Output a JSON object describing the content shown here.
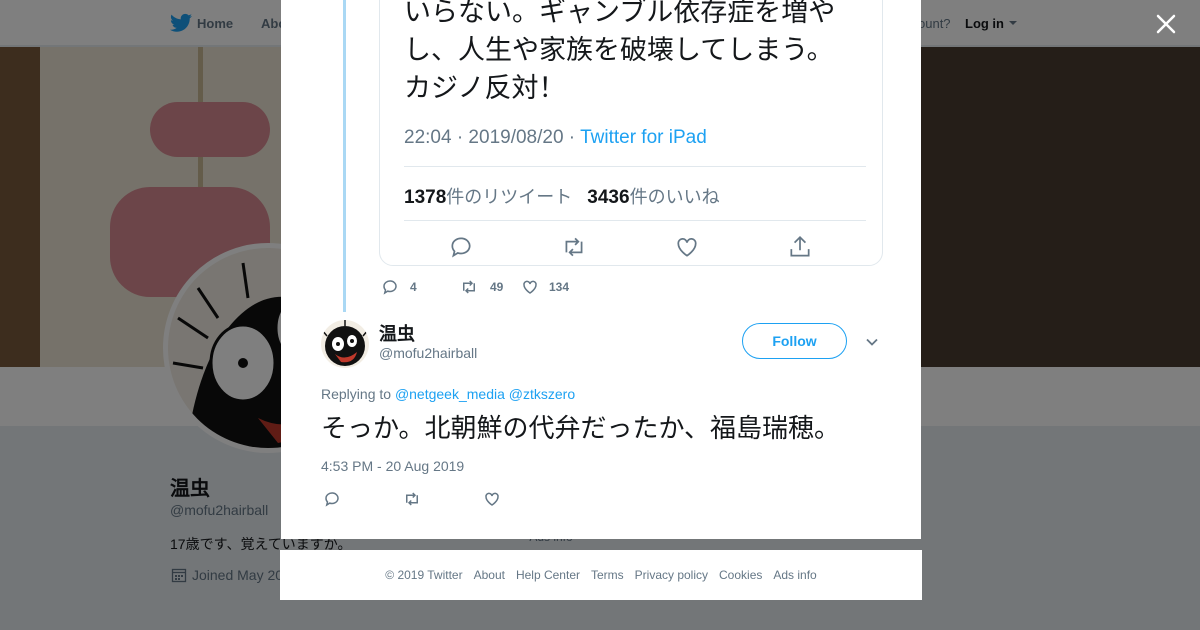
{
  "nav": {
    "home_label": "Home",
    "about_label": "Abo",
    "account_prompt": "ccount?",
    "login_label": "Log in"
  },
  "profile": {
    "name": "温虫",
    "handle": "@mofu2hairball",
    "bio": "17歳です、覚えていますか。",
    "joined": "Joined May 20"
  },
  "background_ads_info": "Ads info",
  "quoted_tweet": {
    "text_line1": "いらない。ギャンブル依存症を増や",
    "text_line2": "し、人生や家族を破壊してしまう。",
    "text_line3": "カジノ反対！",
    "meta_time": "22:04 · 2019/08/20 · ",
    "meta_source": "Twitter for iPad",
    "retweets_count": "1378",
    "retweets_label": "件のリツイート",
    "likes_count": "3436",
    "likes_label": "件のいいね"
  },
  "previous_tweet_stats": {
    "replies": "4",
    "retweets": "49",
    "likes": "134"
  },
  "tweet": {
    "name": "温虫",
    "handle": "@mofu2hairball",
    "follow_label": "Follow",
    "replying_prefix": "Replying to ",
    "mention1": "@netgeek_media",
    "mention2": "@ztkszero",
    "text": "そっか。北朝鮮の代弁だったか、福島瑞穂。",
    "timestamp": "4:53 PM - 20 Aug 2019"
  },
  "footer": {
    "copyright": "© 2019 Twitter",
    "about": "About",
    "help": "Help Center",
    "terms": "Terms",
    "privacy": "Privacy policy",
    "cookies": "Cookies",
    "ads": "Ads info"
  },
  "colors": {
    "accent": "#1da1f2",
    "text_primary": "#14171a",
    "text_secondary": "#657786",
    "border": "#e1e8ed"
  },
  "icons": [
    "twitter-bird-icon",
    "close-icon",
    "reply-icon",
    "retweet-icon",
    "like-icon",
    "share-icon",
    "chevron-down-icon",
    "calendar-icon"
  ]
}
